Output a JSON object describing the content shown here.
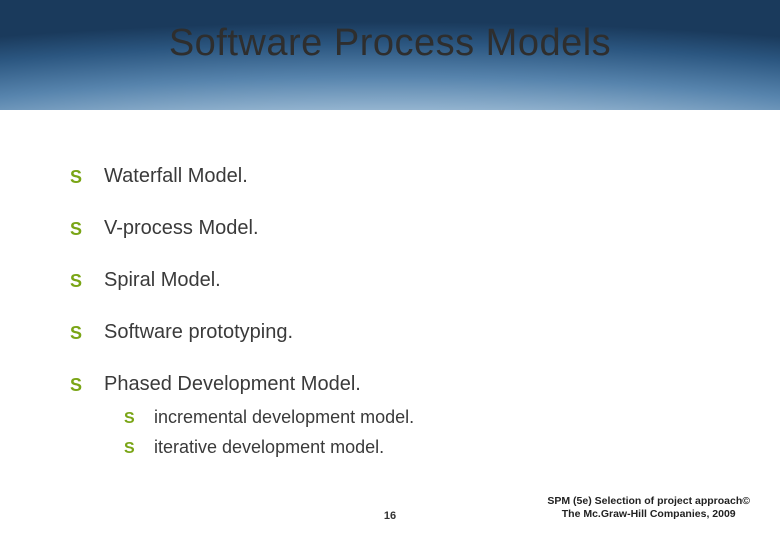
{
  "slide": {
    "title": "Software Process Models",
    "bullets": [
      {
        "text": "Waterfall Model."
      },
      {
        "text": "V-process Model."
      },
      {
        "text": "Spiral Model."
      },
      {
        "text": "Software prototyping."
      },
      {
        "text": "Phased Development Model."
      }
    ],
    "sub_bullets": [
      {
        "text": "incremental development model."
      },
      {
        "text": "iterative development model."
      }
    ],
    "page_number": "16",
    "attribution_line1": "SPM (5e)  Selection of project approach©",
    "attribution_line2": "The Mc.Graw-Hill Companies, 2009"
  }
}
